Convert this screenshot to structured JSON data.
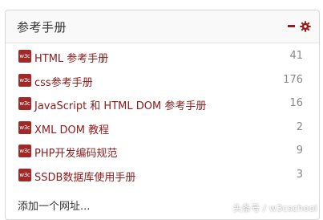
{
  "panel": {
    "title": "参考手册",
    "minimize_icon": "minimize-icon",
    "settings_icon": "gear-icon",
    "accent_color": "#9b1b1b"
  },
  "items": [
    {
      "icon_text": "w3c",
      "label": "HTML 参考手册",
      "count": "41"
    },
    {
      "icon_text": "w3c",
      "label": "css参考手册",
      "count": "176"
    },
    {
      "icon_text": "w3c",
      "label": "JavaScript 和 HTML DOM 参考手册",
      "count": "16"
    },
    {
      "icon_text": "w3c",
      "label": "XML DOM 教程",
      "count": "2"
    },
    {
      "icon_text": "w3c",
      "label": "PHP开发编码规范",
      "count": "9"
    },
    {
      "icon_text": "w3c",
      "label": "SSDB数据库使用手册",
      "count": "3"
    }
  ],
  "add_link": "添加一个网址...",
  "watermark": "头条号 / w3cschool"
}
